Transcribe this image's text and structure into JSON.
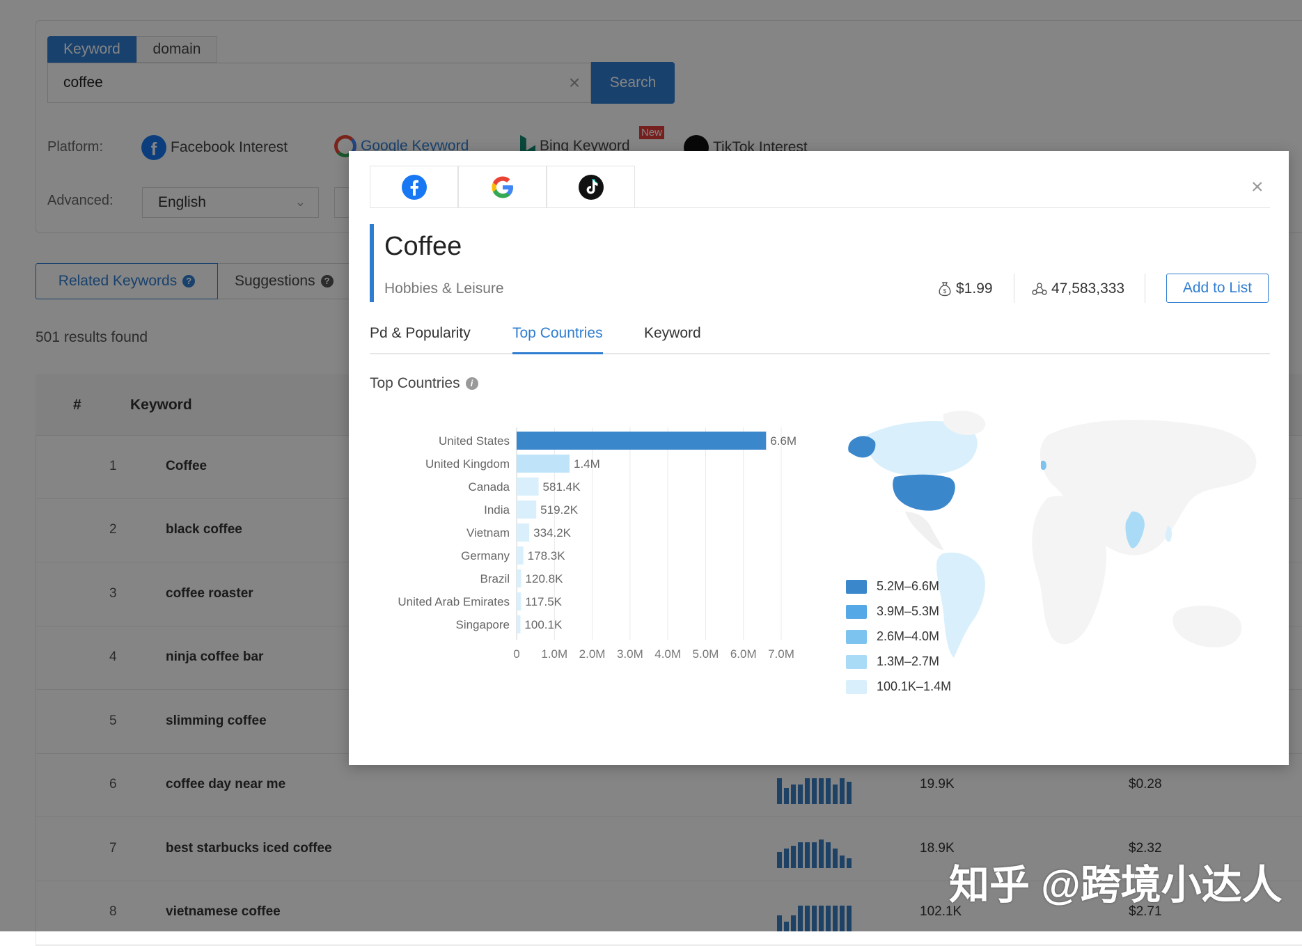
{
  "search": {
    "tabs": [
      "Keyword",
      "domain"
    ],
    "query": "coffee",
    "search_label": "Search"
  },
  "filters": {
    "platform_label": "Platform:",
    "platforms": [
      {
        "label": "Facebook Interest",
        "icon": "facebook-icon"
      },
      {
        "label": "Google Keyword",
        "icon": "google-icon"
      },
      {
        "label": "Bing Keyword",
        "icon": "bing-icon",
        "badge": "New"
      },
      {
        "label": "TikTok Interest",
        "icon": "tiktok-icon"
      }
    ],
    "advanced_label": "Advanced:",
    "language": "English"
  },
  "results": {
    "tabs": [
      "Related Keywords",
      "Suggestions"
    ],
    "count_text": "501 results found",
    "columns": [
      "#",
      "Keyword"
    ],
    "rows": [
      {
        "num": "1",
        "keyword": "Coffee",
        "volume": "",
        "cpc": "",
        "edge": "5"
      },
      {
        "num": "2",
        "keyword": "black coffee",
        "volume": "",
        "cpc": "",
        "edge": "28"
      },
      {
        "num": "3",
        "keyword": "coffee roaster",
        "volume": "",
        "cpc": "",
        "edge": "25"
      },
      {
        "num": "4",
        "keyword": "ninja coffee bar",
        "volume": "",
        "cpc": "",
        "edge": "10"
      },
      {
        "num": "5",
        "keyword": "slimming coffee",
        "volume": "",
        "cpc": "",
        "edge": "10"
      },
      {
        "num": "6",
        "keyword": "coffee day near me",
        "volume": "19.9K",
        "cpc": "$0.28",
        "edge": "2"
      },
      {
        "num": "7",
        "keyword": "best starbucks iced coffee",
        "volume": "18.9K",
        "cpc": "$2.32",
        "edge": "5"
      },
      {
        "num": "8",
        "keyword": "vietnamese coffee",
        "volume": "102.1K",
        "cpc": "$2.71",
        "edge": "87"
      }
    ],
    "trend_bars": [
      [
        0.8,
        0.5,
        0.6,
        0.6,
        0.8,
        0.8,
        0.8,
        0.8,
        0.6,
        0.8,
        0.7
      ],
      [
        0.5,
        0.6,
        0.7,
        0.8,
        0.8,
        0.8,
        0.9,
        0.8,
        0.6,
        0.4,
        0.3
      ],
      [
        0.5,
        0.3,
        0.5,
        0.8,
        0.8,
        0.8,
        0.8,
        0.8,
        0.8,
        0.8,
        0.8
      ]
    ]
  },
  "modal": {
    "title": "Coffee",
    "category": "Hobbies & Leisure",
    "cpc": "$1.99",
    "audience": "47,583,333",
    "add_label": "Add to List",
    "subtabs": [
      "Pd & Popularity",
      "Top Countries",
      "Keyword"
    ],
    "section_title": "Top Countries",
    "legend": [
      {
        "label": "5.2M–6.6M",
        "color": "#3b87cc"
      },
      {
        "label": "3.9M–5.3M",
        "color": "#55a8e6"
      },
      {
        "label": "2.6M–4.0M",
        "color": "#7cc3f0"
      },
      {
        "label": "1.3M–2.7M",
        "color": "#a9dbf7"
      },
      {
        "label": "100.1K–1.4M",
        "color": "#d9f0fc"
      }
    ]
  },
  "chart_data": {
    "type": "bar",
    "orientation": "horizontal",
    "categories": [
      "United States",
      "United Kingdom",
      "Canada",
      "India",
      "Vietnam",
      "Germany",
      "Brazil",
      "United Arab Emirates",
      "Singapore"
    ],
    "values": [
      6600000,
      1400000,
      581400,
      519200,
      334200,
      178300,
      120800,
      117500,
      100100
    ],
    "value_labels": [
      "6.6M",
      "1.4M",
      "581.4K",
      "519.2K",
      "334.2K",
      "178.3K",
      "120.8K",
      "117.5K",
      "100.1K"
    ],
    "xlim": [
      0,
      7000000
    ],
    "xticks": [
      0,
      1000000,
      2000000,
      3000000,
      4000000,
      5000000,
      6000000,
      7000000
    ],
    "xtick_labels": [
      "0",
      "1.0M",
      "2.0M",
      "3.0M",
      "4.0M",
      "5.0M",
      "6.0M",
      "7.0M"
    ],
    "colors": {
      "top": "#3b87cc",
      "rest": "#d9f0fc"
    },
    "grid": true
  },
  "watermark": "知乎 @跨境小达人"
}
